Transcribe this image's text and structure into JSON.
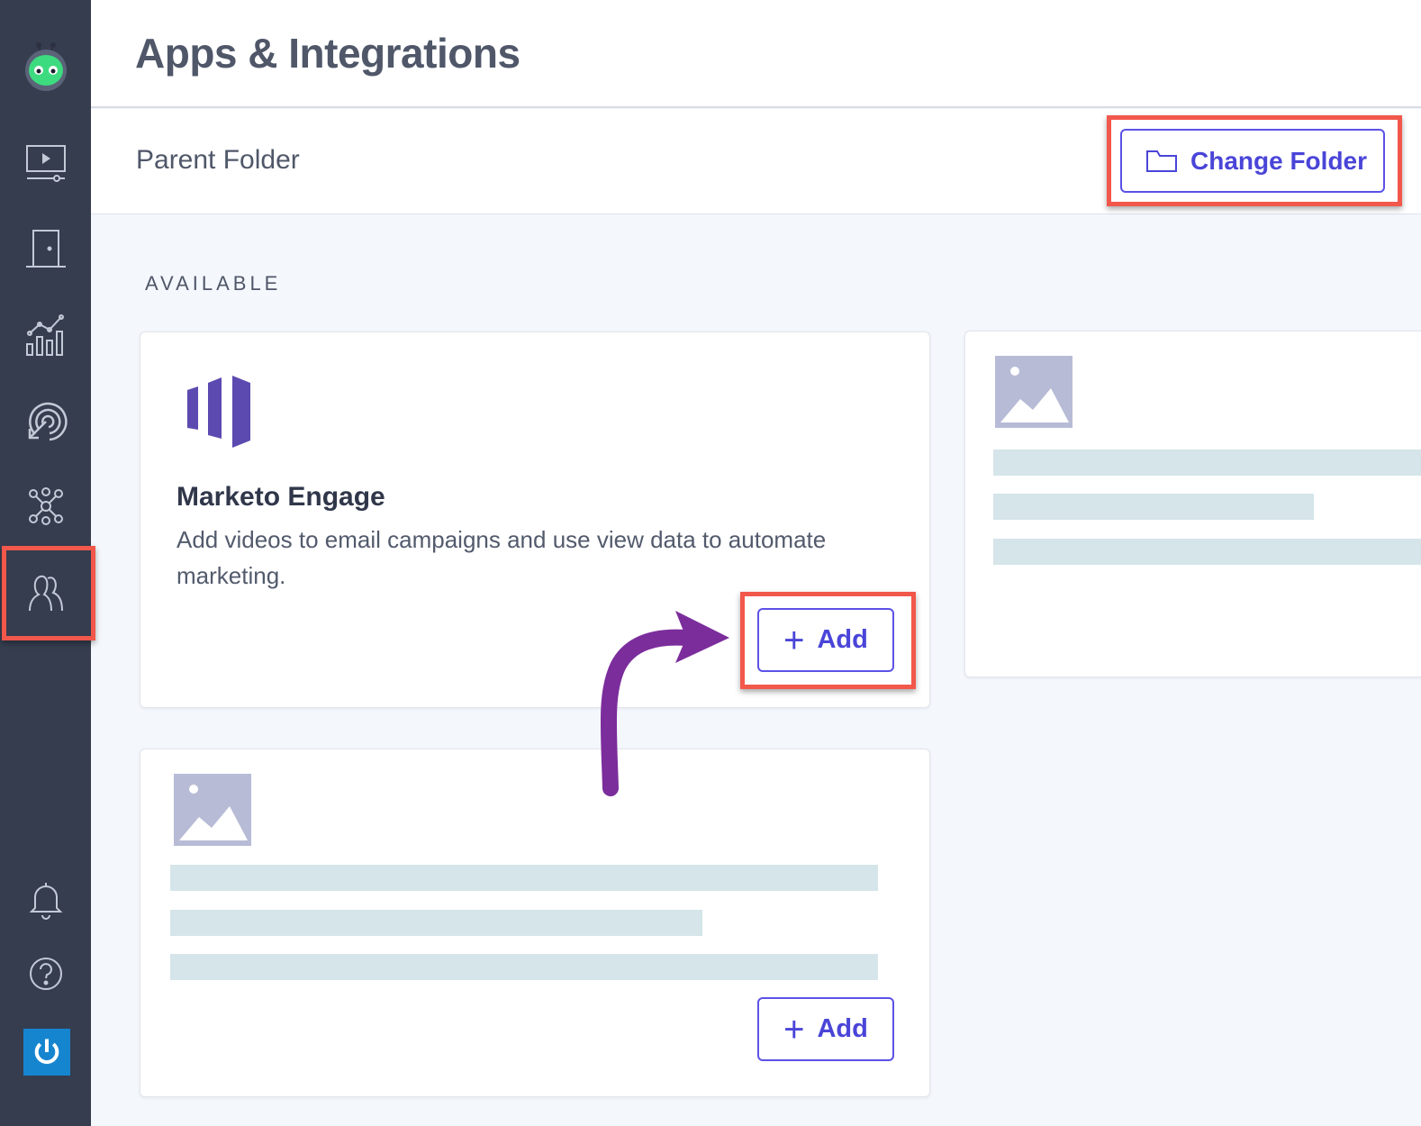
{
  "header": {
    "title": "Apps & Integrations"
  },
  "folder_bar": {
    "label": "Parent Folder",
    "change_folder_label": "Change Folder"
  },
  "section": {
    "label": "AVAILABLE"
  },
  "cards": [
    {
      "title": "Marketo Engage",
      "description": "Add videos to email campaigns and use view data to automate marketing.",
      "add_label": "Add",
      "logo": "marketo-logo"
    },
    {
      "placeholder": true,
      "icon": "image-placeholder-icon"
    },
    {
      "placeholder": true,
      "icon": "image-placeholder-icon",
      "add_label": "Add"
    }
  ],
  "sidebar": {
    "items": [
      {
        "icon": "app-logo-icon"
      },
      {
        "icon": "video-icon"
      },
      {
        "icon": "door-icon"
      },
      {
        "icon": "analytics-icon"
      },
      {
        "icon": "target-icon"
      },
      {
        "icon": "network-icon"
      },
      {
        "icon": "users-icon",
        "active": true
      },
      {
        "icon": "bell-icon"
      },
      {
        "icon": "help-icon"
      },
      {
        "icon": "power-icon"
      }
    ]
  },
  "colors": {
    "sidebar": "#353d4f",
    "accent": "#5b52e6",
    "highlight": "#f2574b",
    "arrow": "#7b2d9c",
    "skeleton": "#d5e5e9"
  }
}
